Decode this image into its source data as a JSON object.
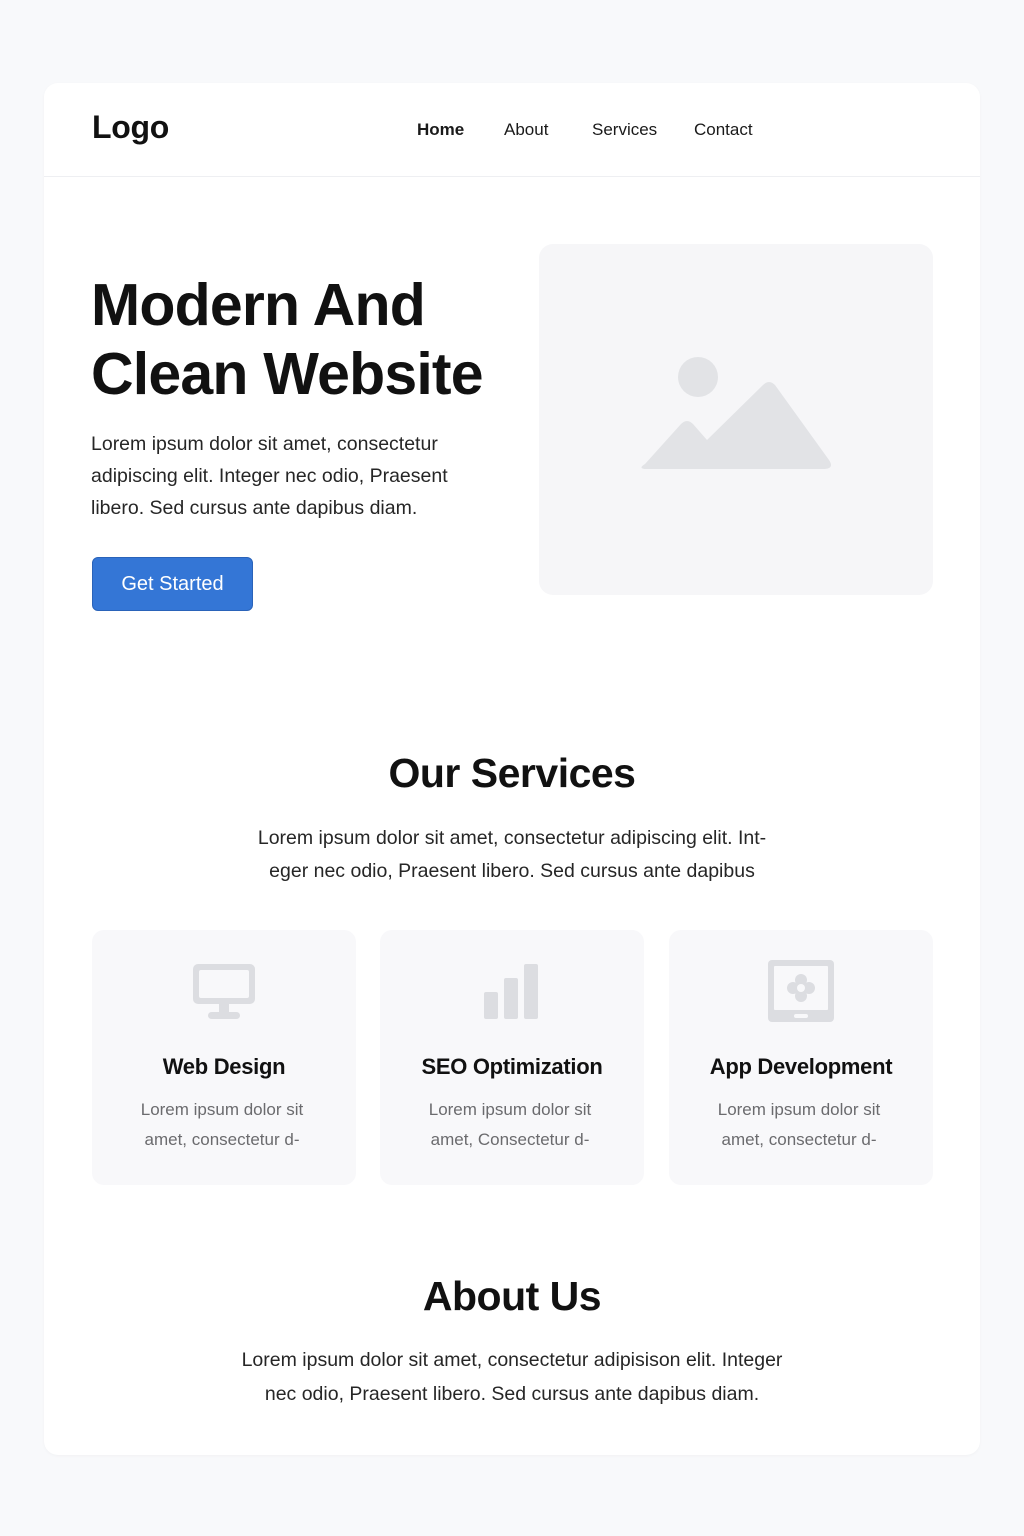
{
  "header": {
    "logo": "Logo",
    "nav": [
      "Home",
      "About",
      "Services",
      "Contact"
    ]
  },
  "hero": {
    "title_line1": "Modern And",
    "title_line2": "Clean Website",
    "text": "Lorem ipsum dolor sit amet, consectetur adipiscing elit. Integer nec odio, Praesent libero. Sed cursus ante dapibus diam.",
    "cta": "Get Started",
    "image_icon": "image-placeholder-icon"
  },
  "services": {
    "title": "Our Services",
    "text_line1": "Lorem ipsum dolor sit amet, consectetur adipiscing elit. Int-",
    "text_line2": "eger nec odio, Praesent libero. Sed cursus ante dapibus",
    "items": [
      {
        "icon": "monitor-icon",
        "title": "Web Design",
        "text_line1": "Lorem ipsum dolor sit",
        "text_line2": "amet, consectetur d-"
      },
      {
        "icon": "bar-chart-icon",
        "title": "SEO Optimization",
        "text_line1": "Lorem ipsum dolor sit",
        "text_line2": "amet, Consectetur d-"
      },
      {
        "icon": "tablet-icon",
        "title": "App Development",
        "text_line1": "Lorem ipsum dolor sit",
        "text_line2": "amet, consectetur d-"
      }
    ]
  },
  "about": {
    "title": "About Us",
    "text_line1": "Lorem ipsum dolor sit amet, consectetur adipisison elit. Integer",
    "text_line2": "nec odio, Praesent libero. Sed cursus ante dapibus diam."
  },
  "colors": {
    "accent": "#3476d6",
    "icon_gray": "#dcdde1",
    "card_bg": "#f8f8fa"
  }
}
